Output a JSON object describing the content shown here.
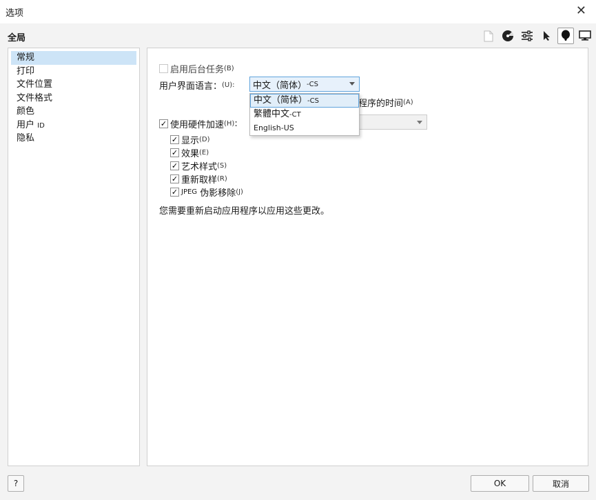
{
  "window": {
    "title": "选项",
    "close_glyph": "✕"
  },
  "header": {
    "title": "全局",
    "toolbar": [
      {
        "icon": "document-icon",
        "active": false
      },
      {
        "icon": "color-disc-icon",
        "active": false
      },
      {
        "icon": "sliders-icon",
        "active": false
      },
      {
        "icon": "pointer-icon",
        "active": false
      },
      {
        "icon": "balloon-icon",
        "active": true
      },
      {
        "icon": "monitor-icon",
        "active": false
      }
    ]
  },
  "sidebar": {
    "items": [
      {
        "label": "常规",
        "selected": true
      },
      {
        "label": "打印",
        "selected": false
      },
      {
        "label": "文件位置",
        "selected": false
      },
      {
        "label": "文件格式",
        "selected": false
      },
      {
        "label": "颜色",
        "selected": false
      },
      {
        "label": "用户",
        "suffix": "ID",
        "selected": false
      },
      {
        "label": "隐私",
        "selected": false
      }
    ]
  },
  "general": {
    "background_tasks": {
      "label": "启用后台任务",
      "accel": "(B)",
      "checked": false
    },
    "ui_language": {
      "label": "用户界面语言：",
      "accel": "(U):",
      "selected": "中文（简体）",
      "selected_code": "-CS",
      "options": [
        {
          "label": "中文（简体）",
          "code": "-CS",
          "highlighted": true
        },
        {
          "label": "繁體中文",
          "code": "-CT",
          "highlighted": false
        },
        {
          "label": "English-US",
          "code": "",
          "highlighted": false
        }
      ]
    },
    "partial_hidden_text": "程序的时间",
    "partial_hidden_accel": "(A)",
    "hw_accel": {
      "label": "使用硬件加速",
      "accel": "(H)",
      "colon": ":",
      "checked": true,
      "sub": [
        {
          "label": "显示",
          "accel": "(D)",
          "checked": true
        },
        {
          "label": "效果",
          "accel": "(E)",
          "checked": true
        },
        {
          "label": "艺术样式",
          "accel": "(S)",
          "checked": true
        },
        {
          "label": "重新取样",
          "accel": "(R)",
          "checked": true
        },
        {
          "label": "伪影移除",
          "prefix": "JPEG",
          "accel": "(J)",
          "checked": true
        }
      ]
    },
    "restart_note": "您需要重新启动应用程序以应用这些更改。"
  },
  "buttons": {
    "help": "?",
    "ok": "OK",
    "cancel": "取消"
  }
}
